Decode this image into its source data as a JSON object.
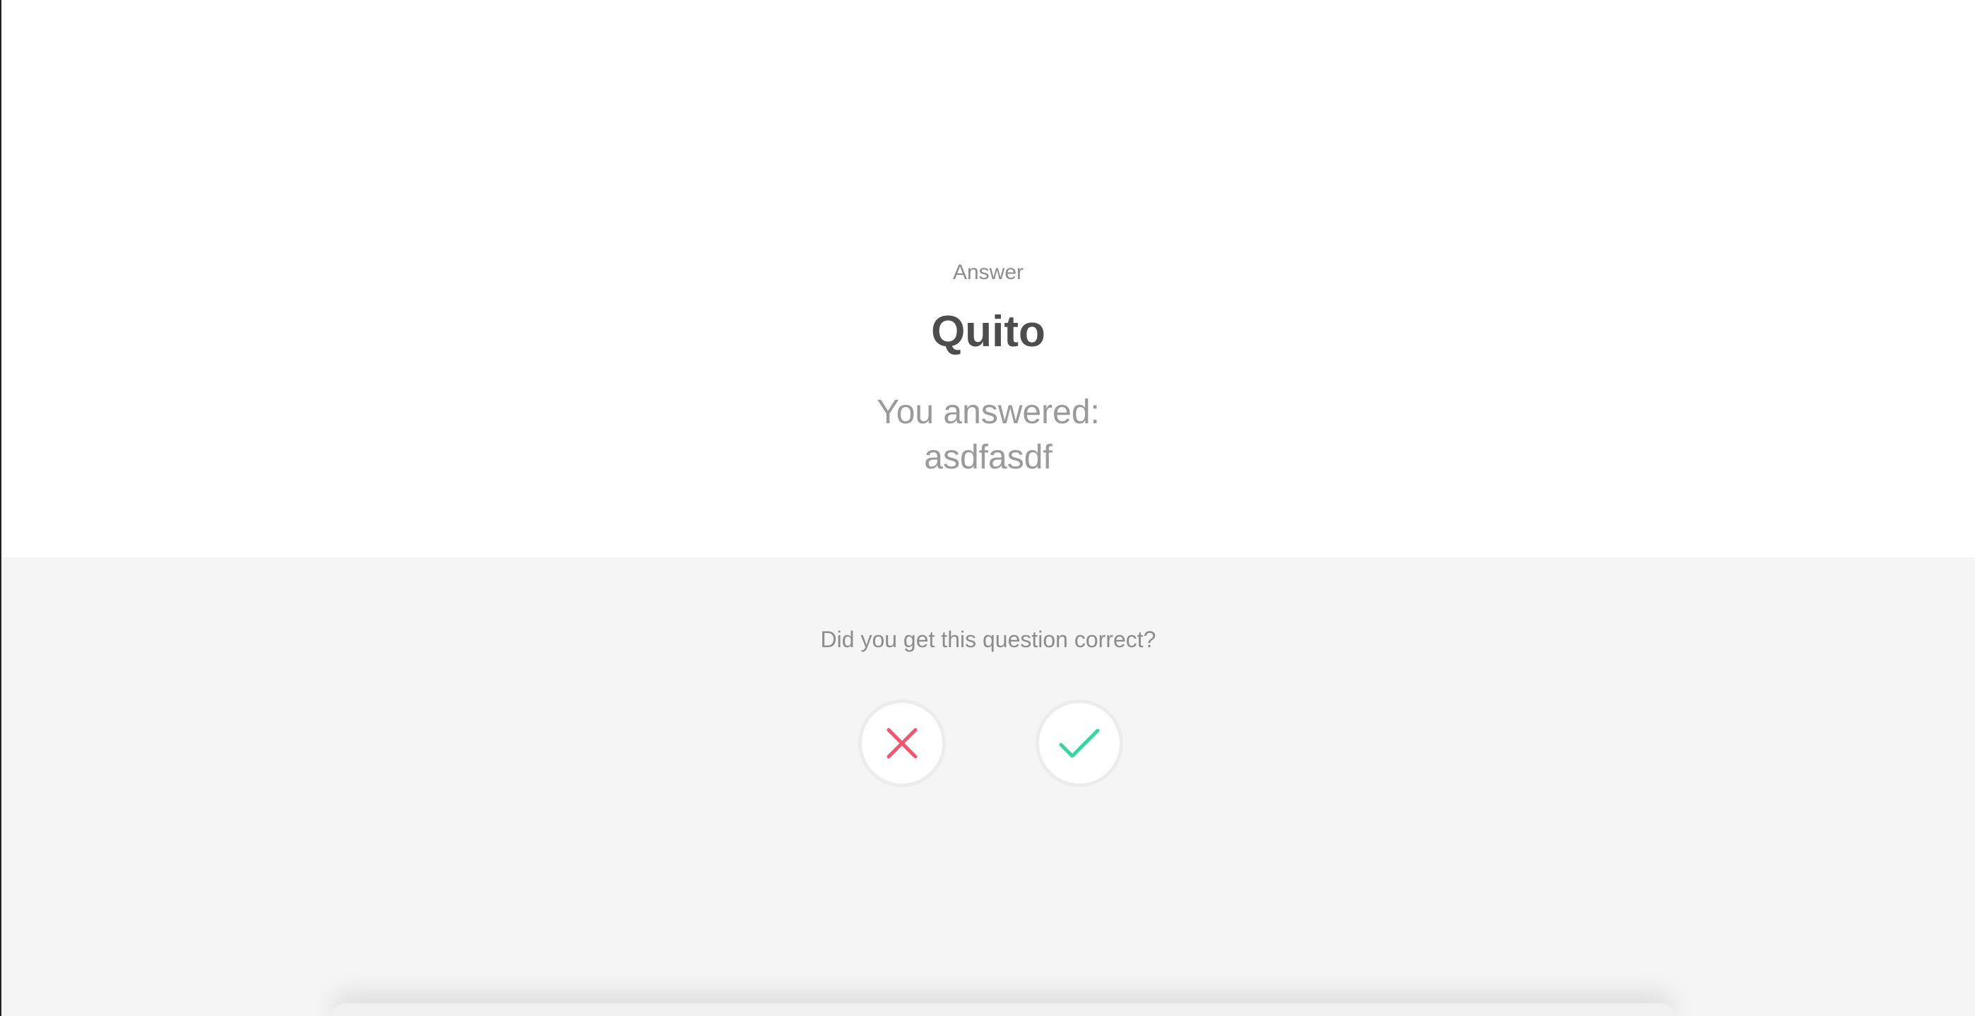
{
  "answer_card": {
    "label": "Answer",
    "value": "Quito",
    "user_answer_prefix": "You answered:",
    "user_answer_value": "asdfasdf"
  },
  "grading": {
    "question": "Did you get this question correct?",
    "incorrect_icon": "x-icon",
    "correct_icon": "check-icon",
    "incorrect_color": "#f0566e",
    "correct_color": "#3dd3a0"
  }
}
